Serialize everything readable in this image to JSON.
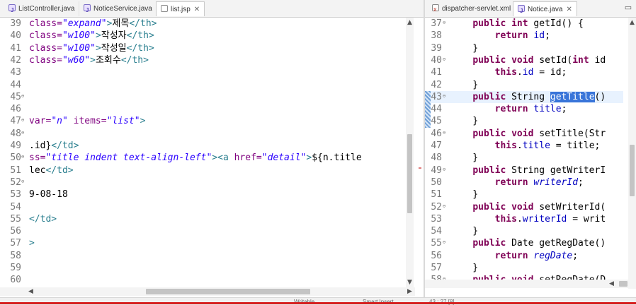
{
  "left_editor": {
    "tabs": [
      {
        "label": "ListController.java",
        "icon": "java-file-icon",
        "active": false
      },
      {
        "label": "NoticeService.java",
        "icon": "java-file-icon",
        "active": false
      },
      {
        "label": "list.jsp",
        "icon": "jsp-file-icon",
        "active": true,
        "close": "✕"
      }
    ],
    "line_numbers": [
      "39",
      "40",
      "41",
      "42",
      "43",
      "44",
      "45",
      "46",
      "47",
      "48",
      "49",
      "50",
      "51",
      "52",
      "53",
      "54",
      "55",
      "56",
      "57",
      "58",
      "59",
      "60"
    ]
  },
  "right_editor": {
    "tabs": [
      {
        "label": "dispatcher-servlet.xml",
        "icon": "xml-file-icon",
        "active": false
      },
      {
        "label": "Notice.java",
        "icon": "java-file-icon",
        "active": true,
        "close": "✕"
      }
    ],
    "line_numbers": [
      "37",
      "38",
      "39",
      "40",
      "41",
      "42",
      "43",
      "44",
      "45",
      "46",
      "47",
      "48",
      "49",
      "50",
      "51",
      "52",
      "53",
      "54",
      "55",
      "56",
      "57",
      "58"
    ]
  },
  "status_bar": {
    "mode": "Writable",
    "insert_mode": "Smart Insert",
    "position": "43 : 27 [8]"
  },
  "colors": {
    "tag": "#2a7f8f",
    "attribute": "#7f007f",
    "string": "#2a00ff",
    "keyword": "#7f0055",
    "field": "#0000c0",
    "selection": "#3975d9",
    "error_bar": "#d61f1f"
  }
}
